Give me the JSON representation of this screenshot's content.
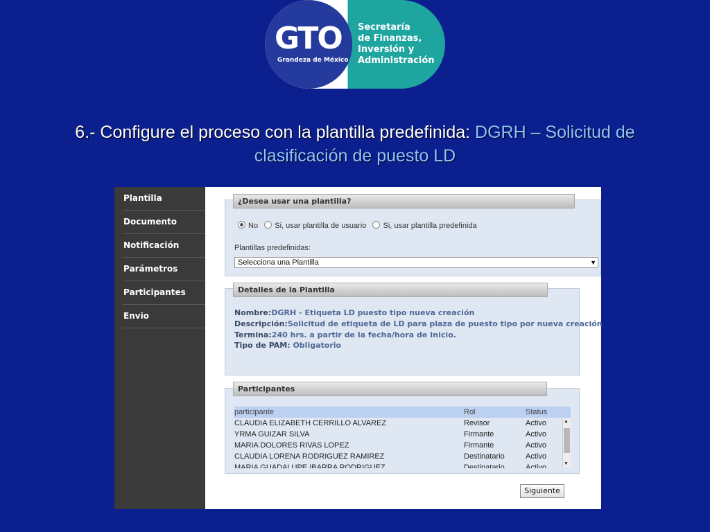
{
  "logo": {
    "brand": "GTO",
    "tagline": "Grandeza de México",
    "lines": [
      "Secretaría",
      "de Finanzas,",
      "Inversión y",
      "Administración"
    ]
  },
  "title": {
    "prefix": "6.- Configure el proceso con la plantilla predefinida: ",
    "highlight": "DGRH – Solicitud de clasificación de puesto LD"
  },
  "sidebar": {
    "items": [
      {
        "label": "Plantilla",
        "active": true
      },
      {
        "label": "Documento"
      },
      {
        "label": "Notificación"
      },
      {
        "label": "Parámetros"
      },
      {
        "label": "Participantes"
      },
      {
        "label": "Envio"
      }
    ]
  },
  "template_section": {
    "header": "¿Desea usar una plantilla?",
    "options": [
      "No",
      "Si, usar plantilla de usuario",
      "Si, usar plantilla predefinida"
    ],
    "selected_option": "No",
    "select_label": "Plantillas predefinidas:",
    "select_value": "Selecciona una Plantilla"
  },
  "details_section": {
    "header": "Detalles de la Plantilla",
    "nombre_label": "Nombre:",
    "nombre_value": "DGRH - Etiqueta LD puesto tipo nueva creación",
    "descripcion_label": "Descripción:",
    "descripcion_value": "Solicitud de etiqueta de LD para plaza de puesto tipo por nueva creación",
    "termina_label": "Termina:",
    "termina_value": "240 hrs. a partir de la fecha/hora de Inicio.",
    "tipo_label": "Tipo de PAM:",
    "tipo_value": "Obligatorio"
  },
  "participants_section": {
    "header": "Participantes",
    "columns": [
      "participante",
      "Rol",
      "Status"
    ],
    "rows": [
      [
        "CLAUDIA ELIZABETH CERRILLO ALVAREZ",
        "Revisor",
        "Activo"
      ],
      [
        "YRMA GUIZAR SILVA",
        "Firmante",
        "Activo"
      ],
      [
        "MARIA DOLORES RIVAS LOPEZ",
        "Firmante",
        "Activo"
      ],
      [
        "CLAUDIA LORENA RODRIGUEZ RAMIREZ",
        "Destinatario",
        "Activo"
      ],
      [
        "MARIA GUADALUPE IBARRA RODRIGUEZ",
        "Destinatario",
        "Activo"
      ]
    ]
  },
  "next_button": "Siguiente"
}
